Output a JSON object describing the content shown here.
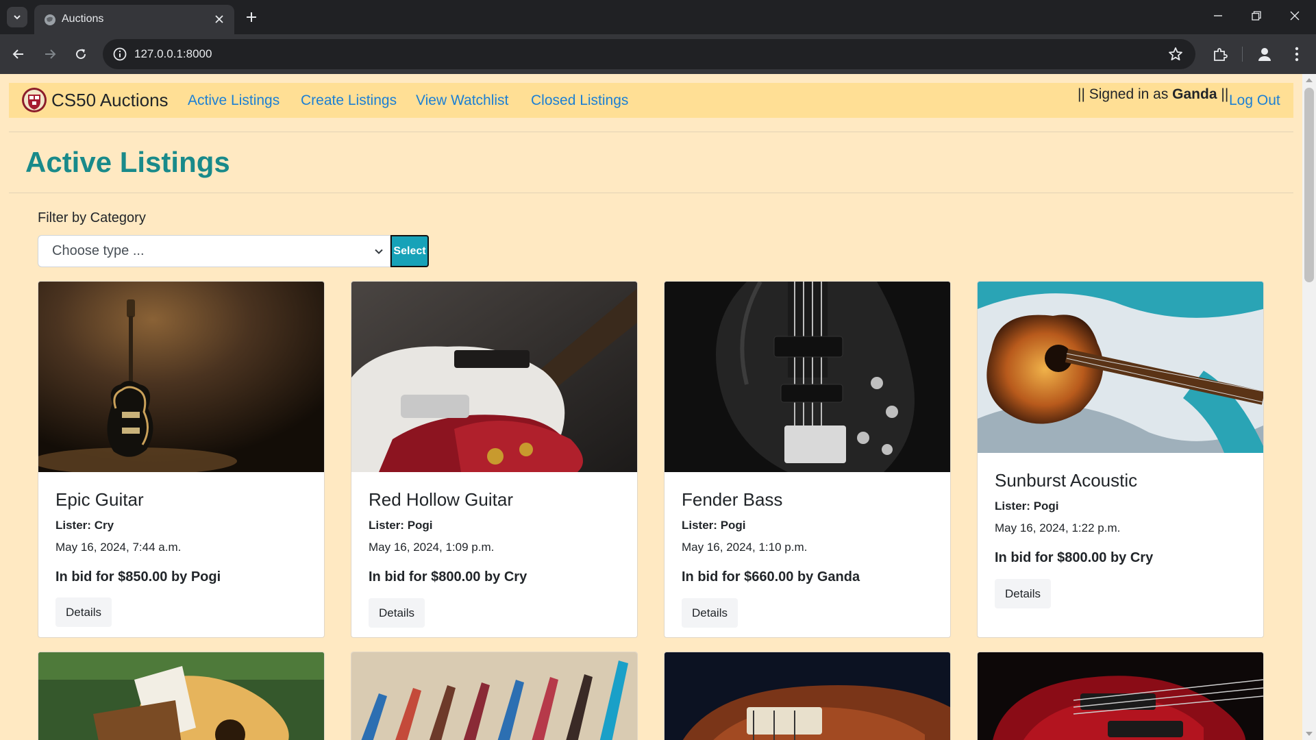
{
  "browser": {
    "tab_title": "Auctions",
    "url": "127.0.0.1:8000"
  },
  "site": {
    "brand": "CS50 Auctions",
    "nav": [
      "Active Listings",
      "Create Listings",
      "View Watchlist",
      "Closed Listings"
    ],
    "signed_prefix": "|| Signed in as",
    "signed_user": "Ganda",
    "signed_suffix": "||",
    "logout": "Log Out"
  },
  "page": {
    "title": "Active Listings",
    "filter_label": "Filter by Category",
    "select_placeholder": "Choose type ...",
    "select_button": "Select"
  },
  "listings": [
    {
      "title": "Epic Guitar",
      "lister_label": "Lister:",
      "lister": "Cry",
      "date": "May 16, 2024, 7:44 a.m.",
      "bid": "In bid for $850.00 by Pogi",
      "button": "Details",
      "image": "electric-guitar-spotlight"
    },
    {
      "title": "Red Hollow Guitar",
      "lister_label": "Lister:",
      "lister": "Pogi",
      "date": "May 16, 2024, 1:09 p.m.",
      "bid": "In bid for $800.00 by Cry",
      "button": "Details",
      "image": "red-hollow-guitar"
    },
    {
      "title": "Fender Bass",
      "lister_label": "Lister:",
      "lister": "Pogi",
      "date": "May 16, 2024, 1:10 p.m.",
      "bid": "In bid for $660.00 by Ganda",
      "button": "Details",
      "image": "black-bass-guitar"
    },
    {
      "title": "Sunburst Acoustic",
      "lister_label": "Lister:",
      "lister": "Pogi",
      "date": "May 16, 2024, 1:22 p.m.",
      "bid": "In bid for $800.00 by Cry",
      "button": "Details",
      "image": "sunburst-acoustic-guitar"
    }
  ],
  "colors": {
    "page_bg": "#ffe9c2",
    "nav_bg": "#ffdf95",
    "link": "#1b7fd4",
    "title": "#198a8a",
    "select_button": "#17a2b8"
  }
}
